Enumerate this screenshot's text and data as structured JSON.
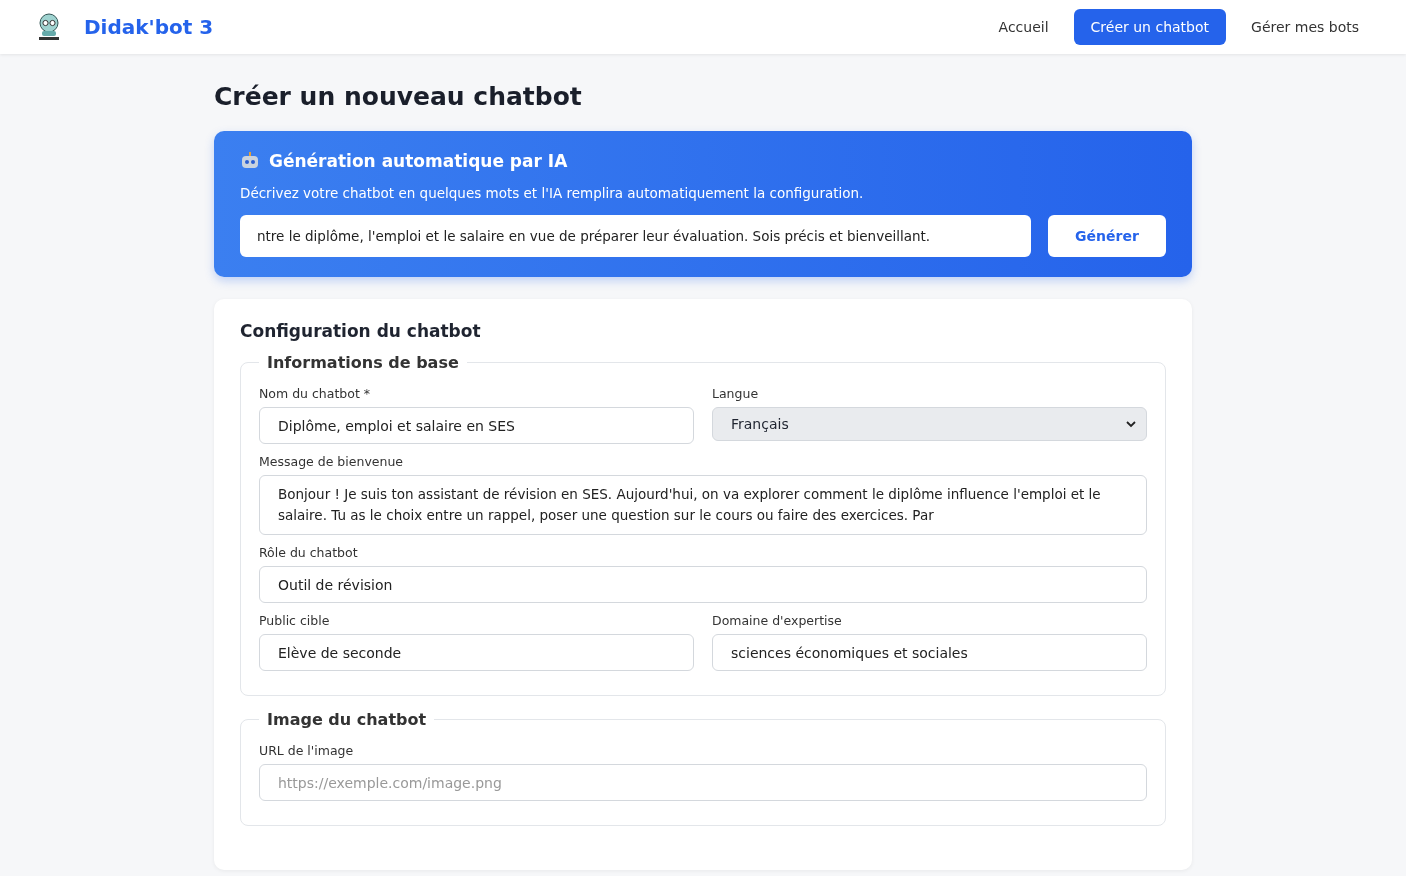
{
  "header": {
    "brand": "Didak'bot 3",
    "nav": [
      {
        "label": "Accueil",
        "selected": false
      },
      {
        "label": "Créer un chatbot",
        "selected": true
      },
      {
        "label": "Gérer mes bots",
        "selected": false
      }
    ]
  },
  "page_title": "Créer un nouveau chatbot",
  "ai_generation": {
    "title": "Génération automatique par IA",
    "description": "Décrivez votre chatbot en quelques mots et l'IA remplira automatiquement la configuration.",
    "input_value": "ntre le diplôme, l'emploi et le salaire en vue de préparer leur évaluation. Sois précis et bienveillant.",
    "button": "Générer"
  },
  "config": {
    "title": "Configuration du chatbot",
    "sections": [
      {
        "legend": "Informations de base",
        "rows": [
          [
            {
              "kind": "input",
              "label": "Nom du chatbot *",
              "value": "Diplôme, emploi et salaire en SES"
            },
            {
              "kind": "select",
              "label": "Langue",
              "value": "Français"
            }
          ],
          [
            {
              "kind": "textarea",
              "label": "Message de bienvenue",
              "value": "Bonjour ! Je suis ton assistant de révision en SES. Aujourd'hui, on va explorer comment le diplôme influence l'emploi et le salaire. Tu as le choix entre un rappel, poser une question sur le cours ou faire des exercices. Par"
            }
          ],
          [
            {
              "kind": "input",
              "label": "Rôle du chatbot",
              "value": "Outil de révision"
            }
          ],
          [
            {
              "kind": "input",
              "label": "Public cible",
              "value": "Elève de seconde"
            },
            {
              "kind": "input",
              "label": "Domaine d'expertise",
              "value": "sciences économiques et sociales"
            }
          ]
        ]
      },
      {
        "legend": "Image du chatbot",
        "rows": [
          [
            {
              "kind": "input",
              "label": "URL de l'image",
              "placeholder": "https://exemple.com/image.png"
            }
          ]
        ]
      }
    ]
  }
}
